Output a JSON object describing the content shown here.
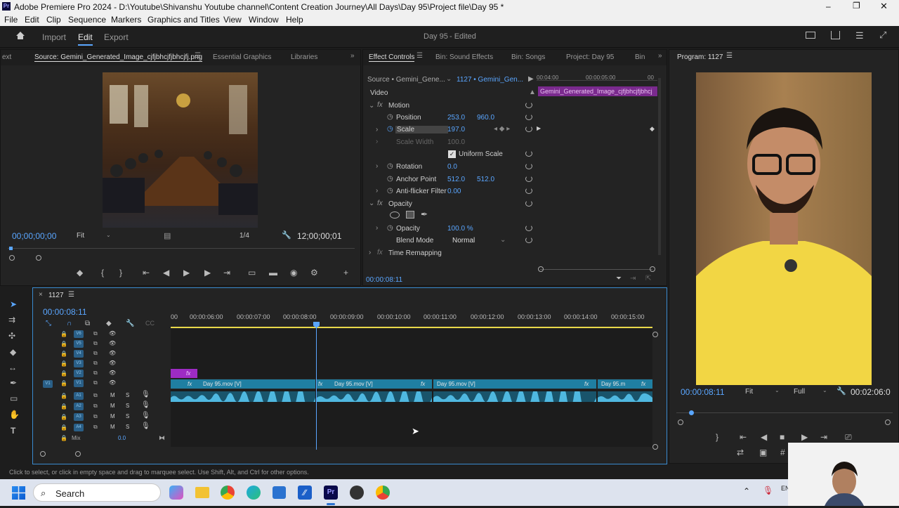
{
  "window": {
    "title": "Adobe Premiere Pro 2024 - D:\\Youtube\\Shivanshu Youtube channel\\Content Creation Journey\\All Days\\Day 95\\Project file\\Day 95 *"
  },
  "menu": [
    "File",
    "Edit",
    "Clip",
    "Sequence",
    "Markers",
    "Graphics and Titles",
    "View",
    "Window",
    "Help"
  ],
  "header": {
    "tabs": [
      "Import",
      "Edit",
      "Export"
    ],
    "project": "Day 95",
    "state": "- Edited"
  },
  "source": {
    "tabs": [
      "ext",
      "Source: Gemini_Generated_Image_cjfjbhcjfjbhcjfj.png",
      "Essential Graphics",
      "Libraries"
    ],
    "timecode": "00;00;00;00",
    "fit": "Fit",
    "ratio": "1/4",
    "duration": "12;00;00;01"
  },
  "effects": {
    "tabs": [
      "Effect Controls",
      "Bin: Sound Effects",
      "Bin: Songs",
      "Project: Day 95",
      "Bin"
    ],
    "source_sel": "Source • Gemini_Gene...",
    "seq_sel": "1127 • Gemini_Gen...",
    "ruler": [
      "00:04:00",
      "00:00:05:00",
      "00"
    ],
    "clip_label": "Gemini_Generated_Image_cjfjbhcjfjbhcj",
    "video": "Video",
    "motion": "Motion",
    "position": "Position",
    "pos_x": "253.0",
    "pos_y": "960.0",
    "scale": "Scale",
    "scale_v": "197.0",
    "scale_width": "Scale Width",
    "scale_width_v": "100.0",
    "uniform": "Uniform Scale",
    "rotation": "Rotation",
    "rotation_v": "0.0",
    "anchor": "Anchor Point",
    "anchor_x": "512.0",
    "anchor_y": "512.0",
    "antiflicker": "Anti-flicker Filter",
    "antiflicker_v": "0.00",
    "opacity_grp": "Opacity",
    "opacity": "Opacity",
    "opacity_v": "100.0 %",
    "blend": "Blend Mode",
    "blend_v": "Normal",
    "time_remap": "Time Remapping",
    "timecode": "00:00:08:11"
  },
  "program": {
    "title": "Program: 1127",
    "timecode": "00:00:08:11",
    "fit": "Fit",
    "full": "Full",
    "duration": "00:02:06:0"
  },
  "timeline": {
    "seq": "1127",
    "timecode": "00:00:08:11",
    "ruler": [
      "00",
      "00:00:06:00",
      "00:00:07:00",
      "00:00:08:00",
      "00:00:09:00",
      "00:00:10:00",
      "00:00:11:00",
      "00:00:12:00",
      "00:00:13:00",
      "00:00:14:00",
      "00:00:15:00"
    ],
    "vtracks": [
      "V6",
      "V5",
      "V4",
      "V3",
      "V2",
      "V1"
    ],
    "atracks": [
      "A1",
      "A2",
      "A3",
      "A4"
    ],
    "v1_src": "V1",
    "mix": "Mix",
    "mix_v": "0.0",
    "clips": [
      "Day 95.mov [V]",
      "Day 95.mov [V]",
      "Day 95.mov [V]",
      "Day 95.m"
    ]
  },
  "status": "Click to select, or click in empty space and drag to marquee select. Use Shift, Alt, and Ctrl for other options.",
  "taskbar": {
    "search": "Search"
  }
}
